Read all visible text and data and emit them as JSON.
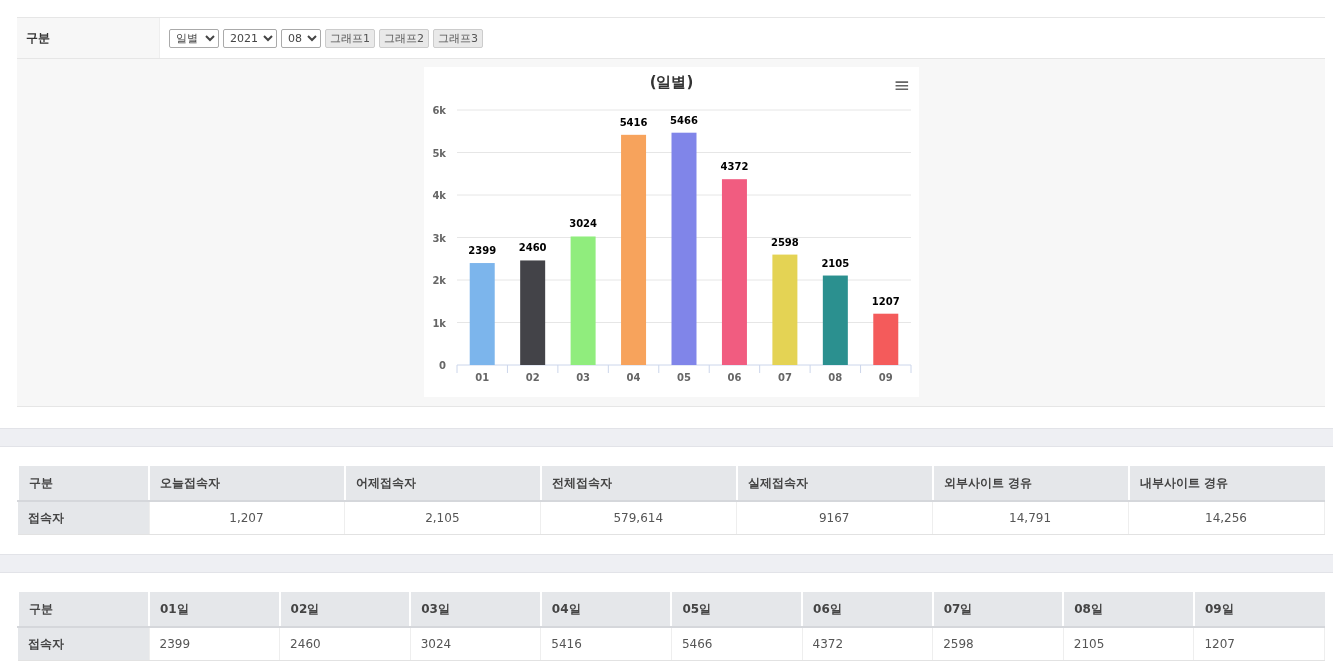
{
  "filter": {
    "label": "구분",
    "selects": [
      {
        "value": "일별"
      },
      {
        "value": "2021"
      },
      {
        "value": "08"
      }
    ],
    "buttons": [
      "그래프1",
      "그래프2",
      "그래프3"
    ]
  },
  "chart": {
    "menu": "≡",
    "chart_data": {
      "type": "bar",
      "title": "(일별)",
      "categories": [
        "01",
        "02",
        "03",
        "04",
        "05",
        "06",
        "07",
        "08",
        "09"
      ],
      "series": [
        {
          "color": "#7cb5ec",
          "values": [
            2399,
            null,
            null,
            null,
            null,
            null,
            null,
            null,
            null
          ]
        },
        {
          "color": "#434348",
          "values": [
            null,
            2460,
            null,
            null,
            null,
            null,
            null,
            null,
            null
          ]
        },
        {
          "color": "#90ed7d",
          "values": [
            null,
            null,
            3024,
            null,
            null,
            null,
            null,
            null,
            null
          ]
        },
        {
          "color": "#f7a35c",
          "values": [
            null,
            null,
            null,
            5416,
            null,
            null,
            null,
            null,
            null
          ]
        },
        {
          "color": "#8085e9",
          "values": [
            null,
            null,
            null,
            null,
            5466,
            null,
            null,
            null,
            null
          ]
        },
        {
          "color": "#f15c80",
          "values": [
            null,
            null,
            null,
            null,
            null,
            4372,
            null,
            null,
            null
          ]
        },
        {
          "color": "#e4d354",
          "values": [
            null,
            null,
            null,
            null,
            null,
            null,
            2598,
            null,
            null
          ]
        },
        {
          "color": "#2b908f",
          "values": [
            null,
            null,
            null,
            null,
            null,
            null,
            null,
            2105,
            null
          ]
        },
        {
          "color": "#f45b5b",
          "values": [
            null,
            null,
            null,
            null,
            null,
            null,
            null,
            null,
            1207
          ]
        }
      ],
      "ylim": [
        0,
        6000
      ],
      "yticks": [
        {
          "value": 0,
          "label": "0"
        },
        {
          "value": 1000,
          "label": "1k"
        },
        {
          "value": 2000,
          "label": "2k"
        },
        {
          "value": 3000,
          "label": "3k"
        },
        {
          "value": 4000,
          "label": "4k"
        },
        {
          "value": 5000,
          "label": "5k"
        },
        {
          "value": 6000,
          "label": "6k"
        }
      ],
      "grid": true,
      "data_labels": true
    }
  },
  "summary_table": {
    "columns": [
      "구분",
      "오늘접속자",
      "어제접속자",
      "전체접속자",
      "실제접속자",
      "외부사이트 경유",
      "내부사이트 경유"
    ],
    "rows": [
      [
        "접속자",
        "1,207",
        "2,105",
        "579,614",
        "9167",
        "14,791",
        "14,256"
      ]
    ]
  },
  "daily_table": {
    "columns": [
      "구분",
      "01일",
      "02일",
      "03일",
      "04일",
      "05일",
      "06일",
      "07일",
      "08일",
      "09일"
    ],
    "rows": [
      [
        "접속자",
        "2399",
        "2460",
        "3024",
        "5416",
        "5466",
        "4372",
        "2598",
        "2105",
        "1207"
      ]
    ]
  }
}
